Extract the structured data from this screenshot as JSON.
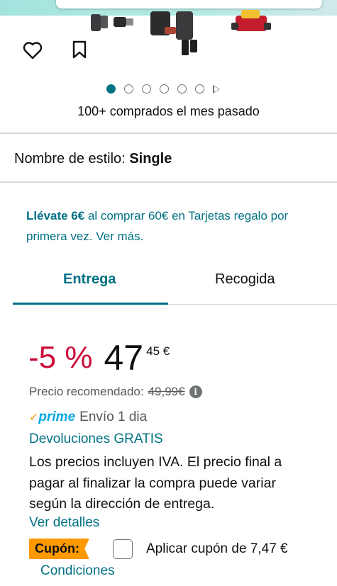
{
  "gallery": {
    "dots_total": 6,
    "active_dot": 0
  },
  "social_proof": {
    "bought_text": "100+ comprados el mes pasado"
  },
  "style": {
    "label": "Nombre de estilo:",
    "value": "Single"
  },
  "promo": {
    "highlight": "Llévate 6€",
    "text": " al comprar 60€ en Tarjetas regalo por primera vez. Ver más."
  },
  "tabs": [
    {
      "label": "Entrega",
      "selected": true
    },
    {
      "label": "Recogida",
      "selected": false
    }
  ],
  "price": {
    "discount": "-5 %",
    "whole": "47",
    "fraction": "45 €",
    "rrp_label": "Precio recomendado:",
    "rrp_value": "49,99€"
  },
  "shipping": {
    "prime_check": "✓",
    "prime_label": "prime",
    "text": "Envío 1 dia"
  },
  "returns": {
    "label": "Devoluciones GRATIS"
  },
  "vat_note": "Los precios incluyen IVA. El precio final a pagar al finalizar la compra puede variar según la dirección de entrega.",
  "details_link": "Ver detalles",
  "coupon": {
    "badge": "Cupón:",
    "text": "Aplicar cupón de 7,47 €",
    "conditions": "Condiciones"
  },
  "colors": {
    "accent": "#007185",
    "discount_red": "#cc0c39",
    "prime_blue": "#00a8e1",
    "coupon_orange": "#ff9900"
  },
  "icons": {
    "wishlist": "heart-icon",
    "save": "bookmark-icon",
    "info": "info-icon",
    "gallery_next": "play-icon"
  }
}
